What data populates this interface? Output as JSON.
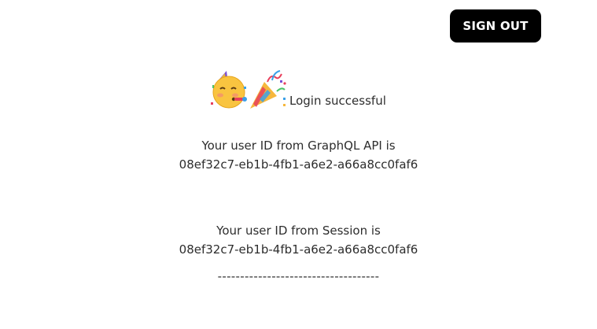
{
  "header": {
    "sign_out_label": "SIGN OUT"
  },
  "hero": {
    "icons": [
      "partying-face-emoji",
      "party-popper-emoji"
    ],
    "message": "Login successful"
  },
  "api_block": {
    "label": "Your user ID from GraphQL API is",
    "user_id": "08ef32c7-eb1b-4fb1-a6e2-a66a8cc0faf6"
  },
  "session_block": {
    "label": "Your user ID from Session is",
    "user_id": "08ef32c7-eb1b-4fb1-a6e2-a66a8cc0faf6"
  },
  "separator": "------------------------------------",
  "colors": {
    "button_bg": "#000000",
    "button_text": "#ffffff",
    "text": "#2d2d2d",
    "background": "#ffffff"
  }
}
